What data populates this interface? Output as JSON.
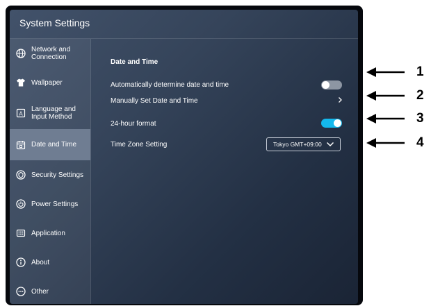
{
  "window": {
    "title": "System Settings"
  },
  "sidebar": {
    "items": [
      {
        "label": "Network and\nConnection",
        "icon": "globe-icon",
        "active": false
      },
      {
        "label": "Wallpaper",
        "icon": "shirt-icon",
        "active": false
      },
      {
        "label": "Language and\nInput Method",
        "icon": "keyboard-a-icon",
        "active": false
      },
      {
        "label": "Date and Time",
        "icon": "calendar-icon",
        "active": true
      },
      {
        "label": "Security Settings",
        "icon": "shield-icon",
        "active": false
      },
      {
        "label": "Power Settings",
        "icon": "power-icon",
        "active": false
      },
      {
        "label": "Application",
        "icon": "grid-icon",
        "active": false
      },
      {
        "label": "About",
        "icon": "info-icon",
        "active": false
      },
      {
        "label": "Other",
        "icon": "ellipsis-icon",
        "active": false
      }
    ]
  },
  "content": {
    "section_title": "Date and Time",
    "auto_date_time": {
      "label": "Automatically determine date and time",
      "enabled": false
    },
    "manual_set": {
      "label": "Manually Set Date and Time"
    },
    "hour_format": {
      "label": "24-hour format",
      "enabled": true
    },
    "time_zone": {
      "label": "Time Zone Setting",
      "value": "Tokyo GMT+09:00"
    }
  },
  "callouts": [
    "1",
    "2",
    "3",
    "4"
  ],
  "colors": {
    "toggle_on": "#14b8ec",
    "toggle_off": "#8d96a3",
    "active_item": "#6f7d92"
  }
}
